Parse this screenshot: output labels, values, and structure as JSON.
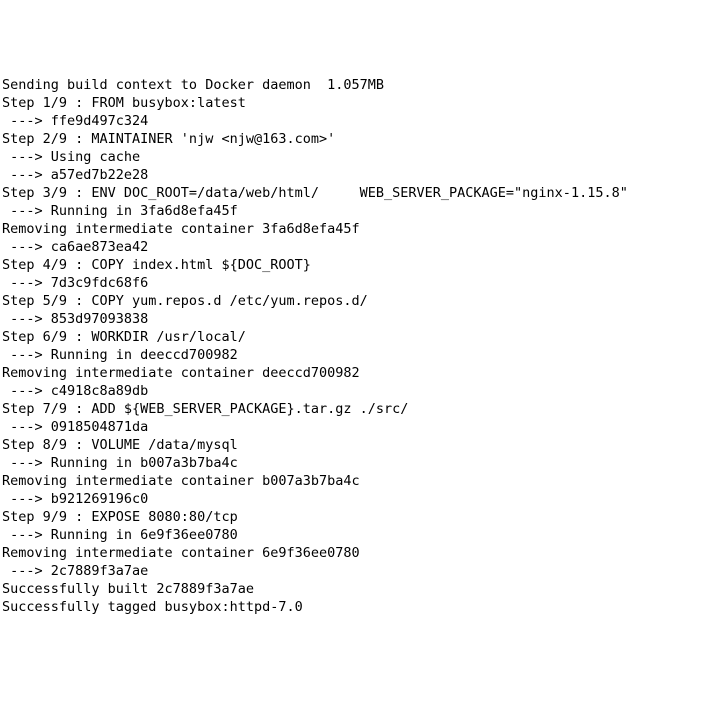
{
  "terminal": {
    "lines": [
      "Sending build context to Docker daemon  1.057MB",
      "Step 1/9 : FROM busybox:latest",
      " ---> ffe9d497c324",
      "Step 2/9 : MAINTAINER 'njw <njw@163.com>'",
      " ---> Using cache",
      " ---> a57ed7b22e28",
      "Step 3/9 : ENV DOC_ROOT=/data/web/html/     WEB_SERVER_PACKAGE=\"nginx-1.15.8\"",
      " ---> Running in 3fa6d8efa45f",
      "Removing intermediate container 3fa6d8efa45f",
      " ---> ca6ae873ea42",
      "Step 4/9 : COPY index.html ${DOC_ROOT}",
      " ---> 7d3c9fdc68f6",
      "Step 5/9 : COPY yum.repos.d /etc/yum.repos.d/",
      " ---> 853d97093838",
      "Step 6/9 : WORKDIR /usr/local/",
      " ---> Running in deeccd700982",
      "Removing intermediate container deeccd700982",
      " ---> c4918c8a89db",
      "Step 7/9 : ADD ${WEB_SERVER_PACKAGE}.tar.gz ./src/",
      " ---> 0918504871da",
      "Step 8/9 : VOLUME /data/mysql",
      " ---> Running in b007a3b7ba4c",
      "Removing intermediate container b007a3b7ba4c",
      " ---> b921269196c0",
      "Step 9/9 : EXPOSE 8080:80/tcp",
      " ---> Running in 6e9f36ee0780",
      "Removing intermediate container 6e9f36ee0780",
      " ---> 2c7889f3a7ae",
      "Successfully built 2c7889f3a7ae",
      "Successfully tagged busybox:httpd-7.0"
    ]
  }
}
